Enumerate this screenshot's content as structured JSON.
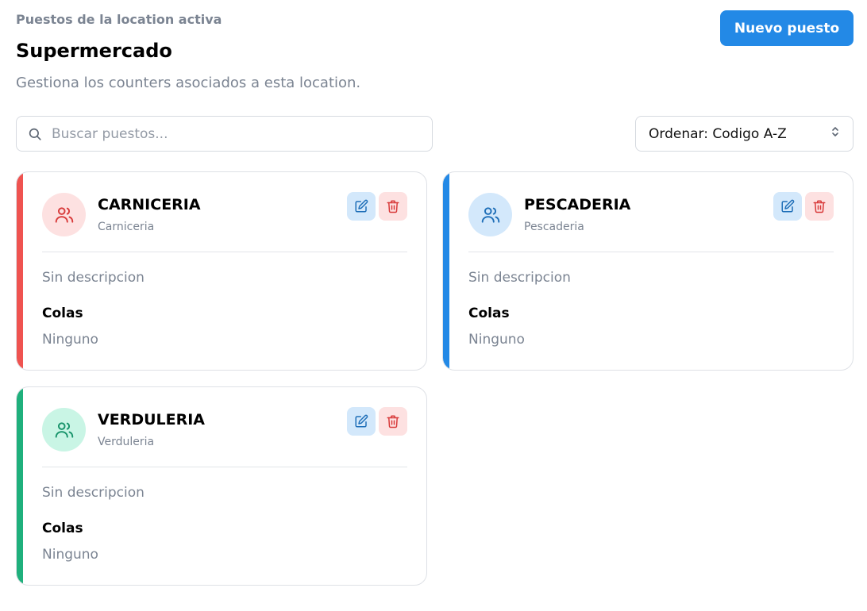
{
  "header": {
    "eyebrow": "Puestos de la location activa",
    "title": "Supermercado",
    "subtitle": "Gestiona los counters asociados a esta location.",
    "new_button": "Nuevo puesto"
  },
  "toolbar": {
    "search_placeholder": "Buscar puestos...",
    "search_value": "",
    "sort_label": "Ordenar: Codigo A-Z"
  },
  "colors": {
    "primary": "#2389e6",
    "red": "#ef5350",
    "blue": "#2389e6",
    "green": "#1fb07c"
  },
  "cards": [
    {
      "name": "CARNICERIA",
      "code": "Carniceria",
      "description": "Sin descripcion",
      "colas_label": "Colas",
      "colas_value": "Ninguno",
      "accent": "#ef5350",
      "avatar_bg": "#fde1e1",
      "icon_color": "#d83a3a",
      "icon": "users-icon"
    },
    {
      "name": "PESCADERIA",
      "code": "Pescaderia",
      "description": "Sin descripcion",
      "colas_label": "Colas",
      "colas_value": "Ninguno",
      "accent": "#2389e6",
      "avatar_bg": "#d3e8fb",
      "icon_color": "#1f6fb8",
      "icon": "users-icon"
    },
    {
      "name": "VERDULERIA",
      "code": "Verduleria",
      "description": "Sin descripcion",
      "colas_label": "Colas",
      "colas_value": "Ninguno",
      "accent": "#1fb07c",
      "avatar_bg": "#c9f5e5",
      "icon_color": "#17936a",
      "icon": "users-icon"
    }
  ]
}
